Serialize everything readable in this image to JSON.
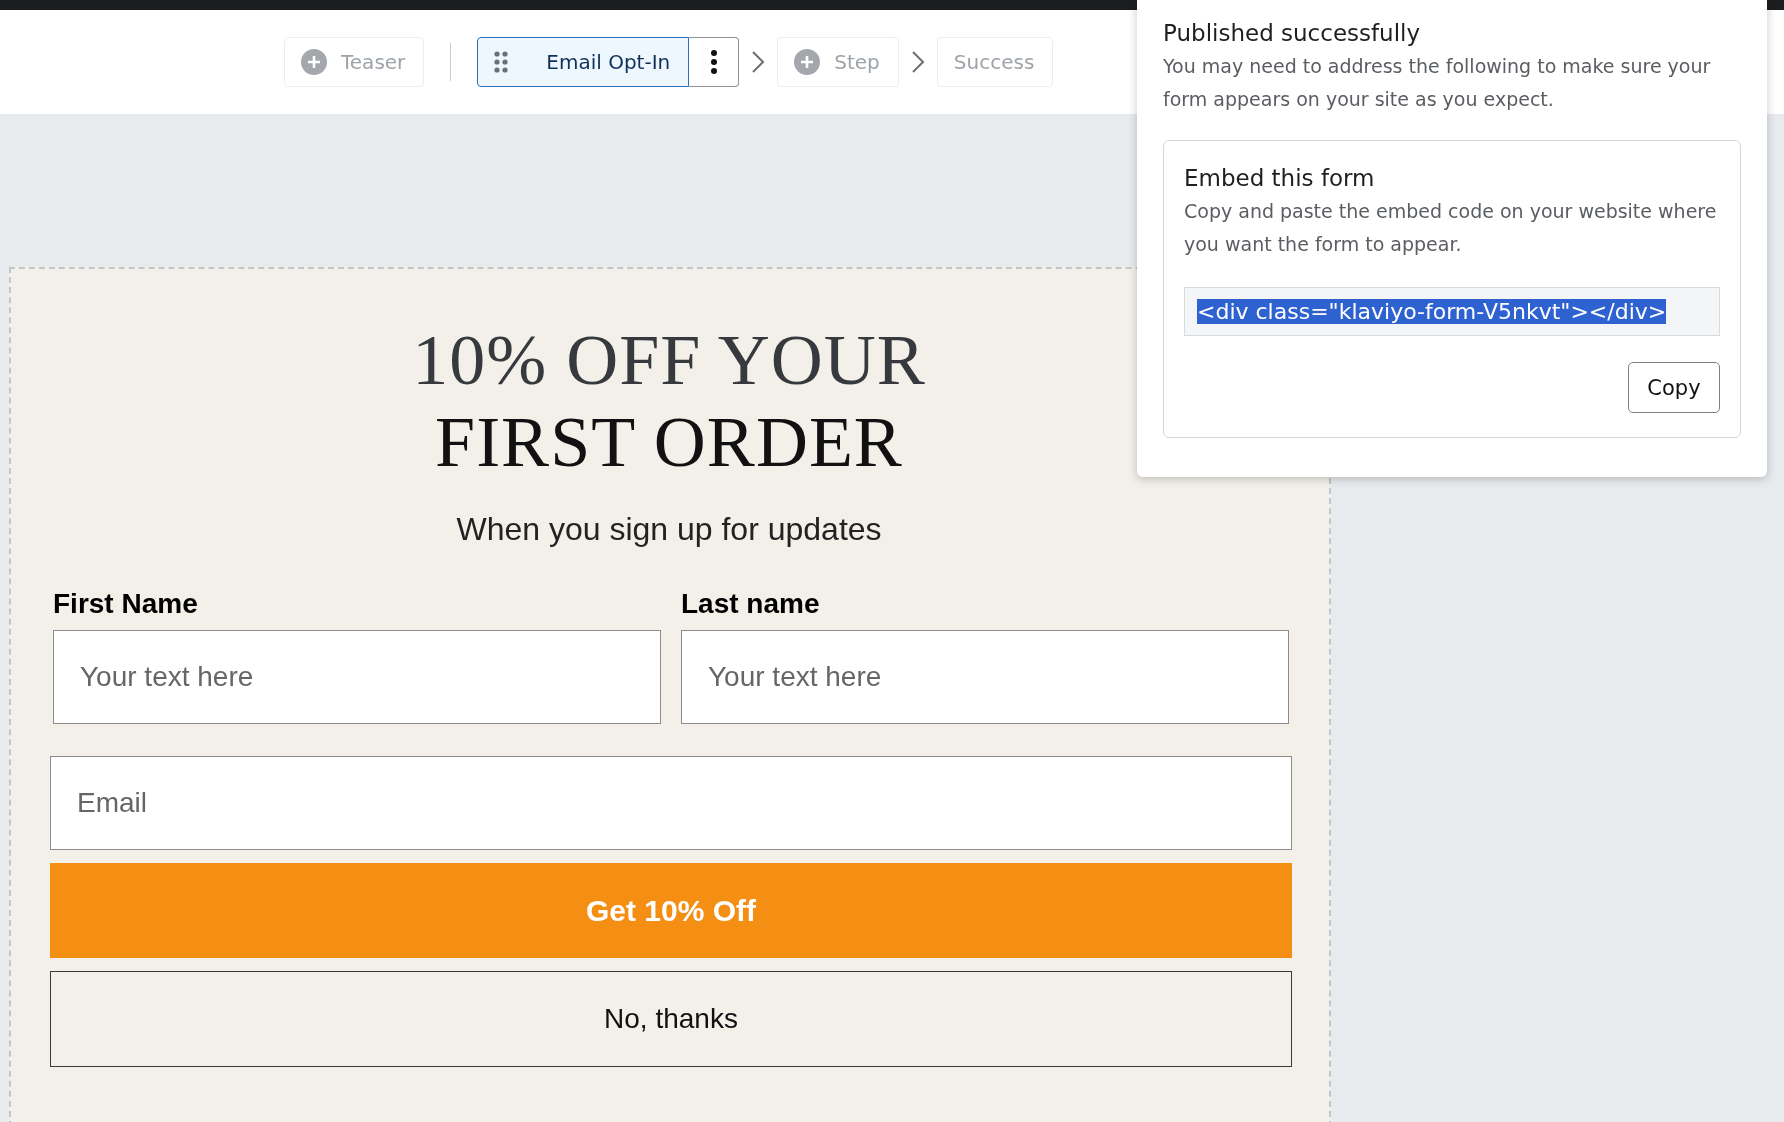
{
  "steps": [
    {
      "kind": "add",
      "label": "Teaser",
      "selected": false
    },
    {
      "kind": "page",
      "label": "Email Opt-In",
      "selected": true
    },
    {
      "kind": "add",
      "label": "Step",
      "selected": false
    },
    {
      "kind": "page",
      "label": "Success",
      "selected": false
    }
  ],
  "form": {
    "heading_line_1": "10% OFF YOUR",
    "heading_line_2": "FIRST ORDER",
    "subtitle": "When you sign up for updates",
    "fields": [
      {
        "label": "First Name",
        "placeholder": "Your text here"
      },
      {
        "label": "Last name",
        "placeholder": "Your text here"
      }
    ],
    "email": {
      "placeholder": "Email"
    },
    "submit_button": "Get 10% Off",
    "decline_button": "No, thanks"
  },
  "popover": {
    "title": "Published successfully",
    "message": "You may need to address the following to make sure your form appears on your site as you expect.",
    "embed": {
      "title": "Embed this form",
      "description": "Copy and paste the embed code on your website where you want the form to appear.",
      "code": "<div class=\"klaviyo-form-V5nkvt\"></div>",
      "copy_button": "Copy"
    }
  }
}
